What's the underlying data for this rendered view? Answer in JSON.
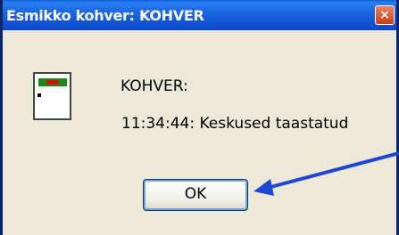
{
  "window": {
    "title": "Esmikko kohver: KOHVER",
    "close_glyph": "×"
  },
  "message": {
    "app_line": "KOHVER:",
    "text": "11:34:44: Keskused taastatud"
  },
  "buttons": {
    "ok_label": "OK"
  },
  "colors": {
    "titlebar": "#0a5fd8",
    "annotation_arrow": "#1e46d6"
  }
}
